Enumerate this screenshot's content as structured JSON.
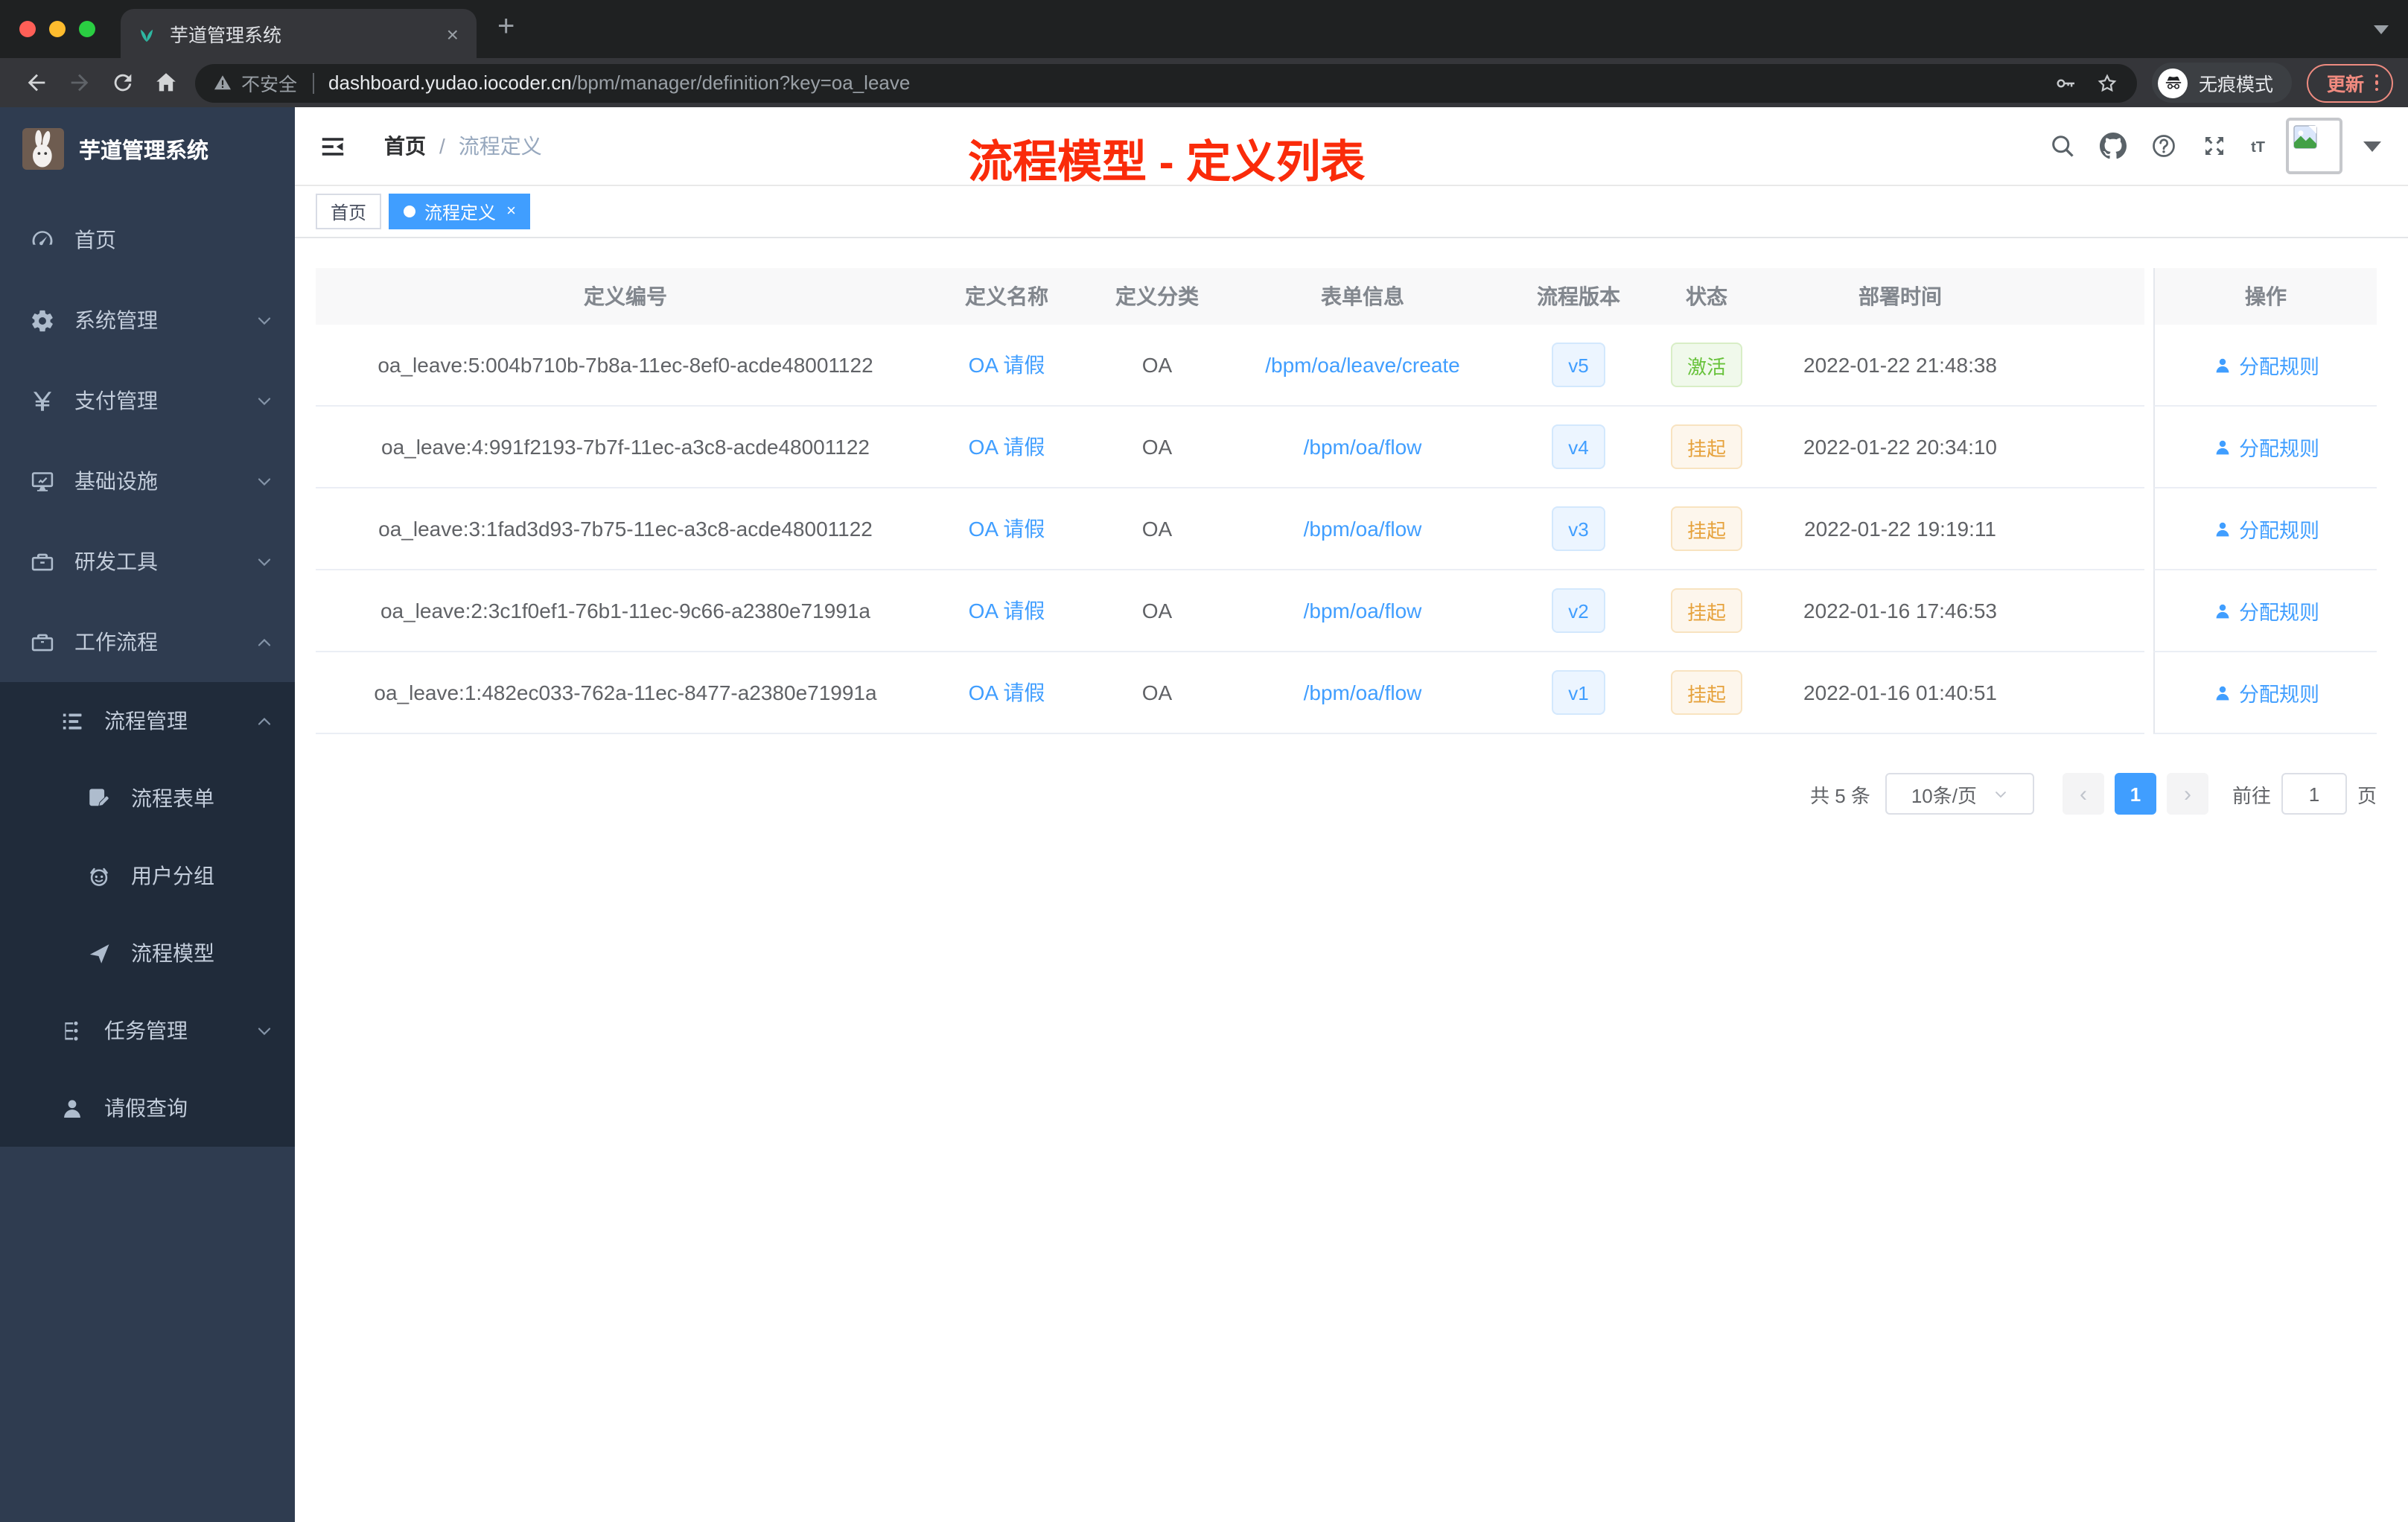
{
  "browser": {
    "tab": {
      "title": "芋道管理系统",
      "close_glyph": "×",
      "new_tab_glyph": "+"
    },
    "toolbar": {
      "security_label": "不安全",
      "url_host": "dashboard.yudao.iocoder.cn",
      "url_path": "/bpm/manager/definition?key=oa_leave",
      "incognito_label": "无痕模式",
      "update_label": "更新"
    }
  },
  "sidebar": {
    "title": "芋道管理系统",
    "items": [
      {
        "label": "首页",
        "icon": "dashboard-icon",
        "level": 0
      },
      {
        "label": "系统管理",
        "icon": "gear-icon",
        "level": 0,
        "chevron": "down"
      },
      {
        "label": "支付管理",
        "icon": "yen-icon",
        "level": 0,
        "chevron": "down"
      },
      {
        "label": "基础设施",
        "icon": "monitor-icon",
        "level": 0,
        "chevron": "down"
      },
      {
        "label": "研发工具",
        "icon": "toolbox-icon",
        "level": 0,
        "chevron": "down"
      },
      {
        "label": "工作流程",
        "icon": "briefcase-icon",
        "level": 0,
        "chevron": "up"
      },
      {
        "label": "流程管理",
        "icon": "flow-list-icon",
        "level": 1,
        "chevron": "up",
        "submenu": true
      },
      {
        "label": "流程表单",
        "icon": "form-icon",
        "level": 2,
        "submenu": true
      },
      {
        "label": "用户分组",
        "icon": "user-group-icon",
        "level": 2,
        "submenu": true
      },
      {
        "label": "流程模型",
        "icon": "paper-plane-icon",
        "level": 2,
        "submenu": true
      },
      {
        "label": "任务管理",
        "icon": "task-tree-icon",
        "level": 1,
        "chevron": "down",
        "submenu": true
      },
      {
        "label": "请假查询",
        "icon": "person-icon",
        "level": 1,
        "submenu": true
      }
    ]
  },
  "header": {
    "breadcrumb": {
      "home": "首页",
      "separator": "/",
      "current": "流程定义"
    },
    "annotation": "流程模型 - 定义列表",
    "font_size_icon_text": "tT"
  },
  "tags": [
    {
      "label": "首页",
      "active": false
    },
    {
      "label": "流程定义",
      "active": true,
      "close_glyph": "×"
    }
  ],
  "table": {
    "columns": [
      "定义编号",
      "定义名称",
      "定义分类",
      "表单信息",
      "流程版本",
      "状态",
      "部署时间",
      "操作"
    ],
    "rows": [
      {
        "id": "oa_leave:5:004b710b-7b8a-11ec-8ef0-acde48001122",
        "name": "OA 请假",
        "category": "OA",
        "form": "/bpm/oa/leave/create",
        "version": "v5",
        "status": "激活",
        "status_type": "success",
        "deploy_time": "2022-01-22 21:48:38",
        "action": "分配规则"
      },
      {
        "id": "oa_leave:4:991f2193-7b7f-11ec-a3c8-acde48001122",
        "name": "OA 请假",
        "category": "OA",
        "form": "/bpm/oa/flow",
        "version": "v4",
        "status": "挂起",
        "status_type": "warning",
        "deploy_time": "2022-01-22 20:34:10",
        "action": "分配规则"
      },
      {
        "id": "oa_leave:3:1fad3d93-7b75-11ec-a3c8-acde48001122",
        "name": "OA 请假",
        "category": "OA",
        "form": "/bpm/oa/flow",
        "version": "v3",
        "status": "挂起",
        "status_type": "warning",
        "deploy_time": "2022-01-22 19:19:11",
        "action": "分配规则"
      },
      {
        "id": "oa_leave:2:3c1f0ef1-76b1-11ec-9c66-a2380e71991a",
        "name": "OA 请假",
        "category": "OA",
        "form": "/bpm/oa/flow",
        "version": "v2",
        "status": "挂起",
        "status_type": "warning",
        "deploy_time": "2022-01-16 17:46:53",
        "action": "分配规则"
      },
      {
        "id": "oa_leave:1:482ec033-762a-11ec-8477-a2380e71991a",
        "name": "OA 请假",
        "category": "OA",
        "form": "/bpm/oa/flow",
        "version": "v1",
        "status": "挂起",
        "status_type": "warning",
        "deploy_time": "2022-01-16 01:40:51",
        "action": "分配规则"
      }
    ]
  },
  "pagination": {
    "total": "共 5 条",
    "page_size": "10条/页",
    "prev_glyph": "‹",
    "next_glyph": "›",
    "current_page": "1",
    "goto_prefix": "前往",
    "goto_value": "1",
    "goto_suffix": "页"
  },
  "colors": {
    "accent": "#409eff",
    "annotation_red": "#fa2b0a",
    "tag_success": "#67c23a",
    "tag_warning": "#e6a23c",
    "sidebar_bg": "#2f3c50",
    "sidebar_submenu_bg": "#202b3a",
    "update_button": "#f08a7f"
  }
}
